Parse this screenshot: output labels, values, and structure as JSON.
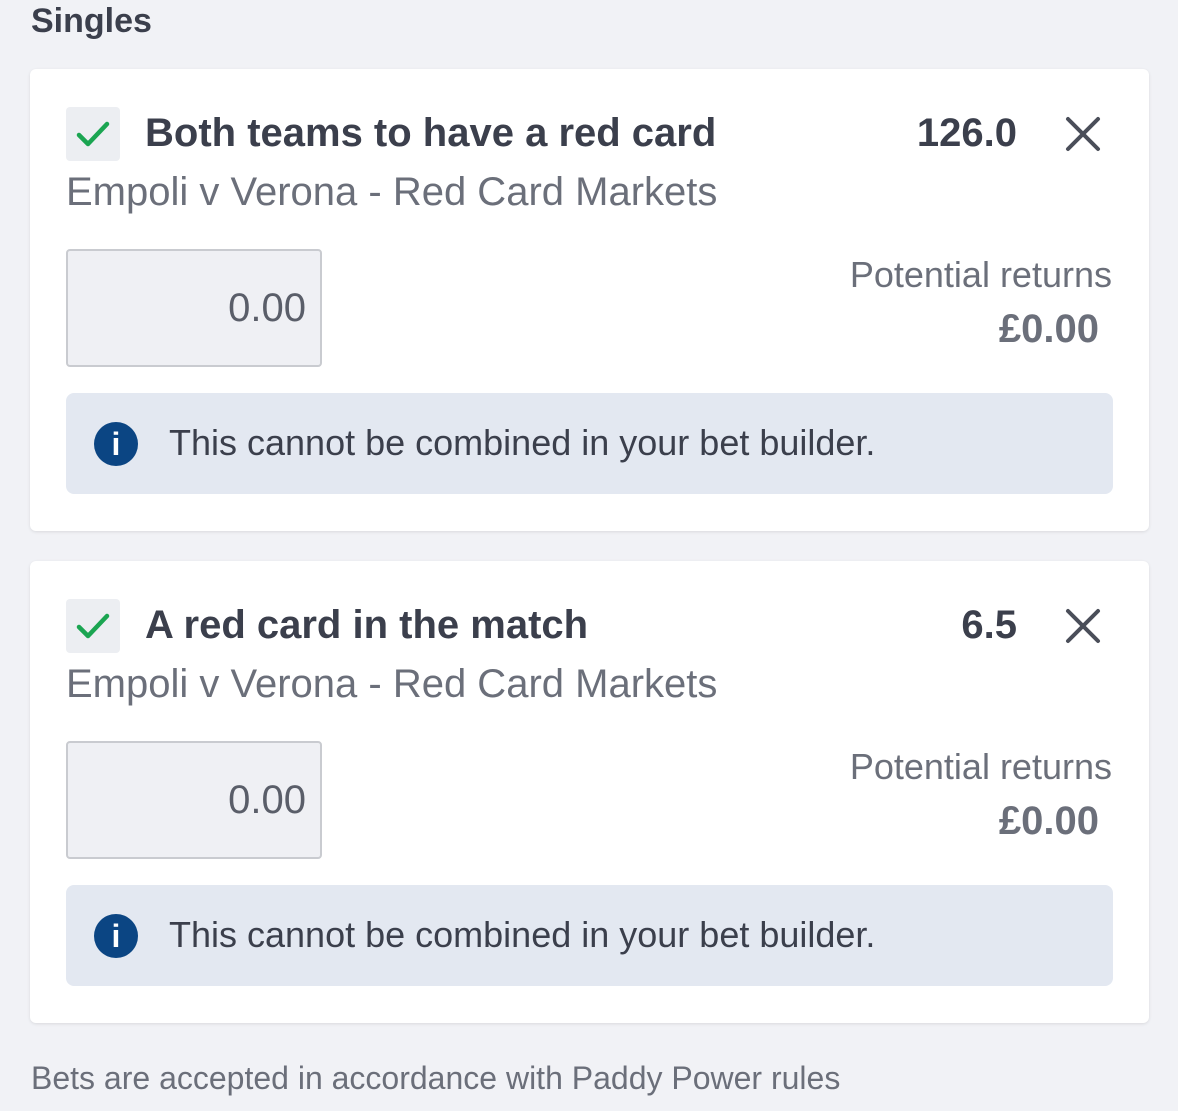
{
  "section_title": "Singles",
  "colors": {
    "page_background": "#f1f2f6",
    "card_background": "#ffffff",
    "check_green": "#1ba552",
    "info_icon_blue": "#0b4583",
    "info_bar_background": "#e3e8f1",
    "primary_text": "#3b3f4c",
    "secondary_text": "#6b6f7a"
  },
  "bets": [
    {
      "selection": "Both teams to have a red card",
      "odds": "126.0",
      "event": "Empoli v Verona - Red Card Markets",
      "stake_placeholder": "0.00",
      "returns_label": "Potential returns",
      "returns_value": "£0.00",
      "info_message": "This cannot be combined in your bet builder.",
      "checked": true,
      "check_icon": "check-icon",
      "remove_icon": "close-icon",
      "info_icon": "info-icon",
      "info_icon_glyph": "i"
    },
    {
      "selection": "A red card in the match",
      "odds": "6.5",
      "event": "Empoli v Verona - Red Card Markets",
      "stake_placeholder": "0.00",
      "returns_label": "Potential returns",
      "returns_value": "£0.00",
      "info_message": "This cannot be combined in your bet builder.",
      "checked": true,
      "check_icon": "check-icon",
      "remove_icon": "close-icon",
      "info_icon": "info-icon",
      "info_icon_glyph": "i"
    }
  ],
  "footer_note": "Bets are accepted in accordance with Paddy Power rules"
}
